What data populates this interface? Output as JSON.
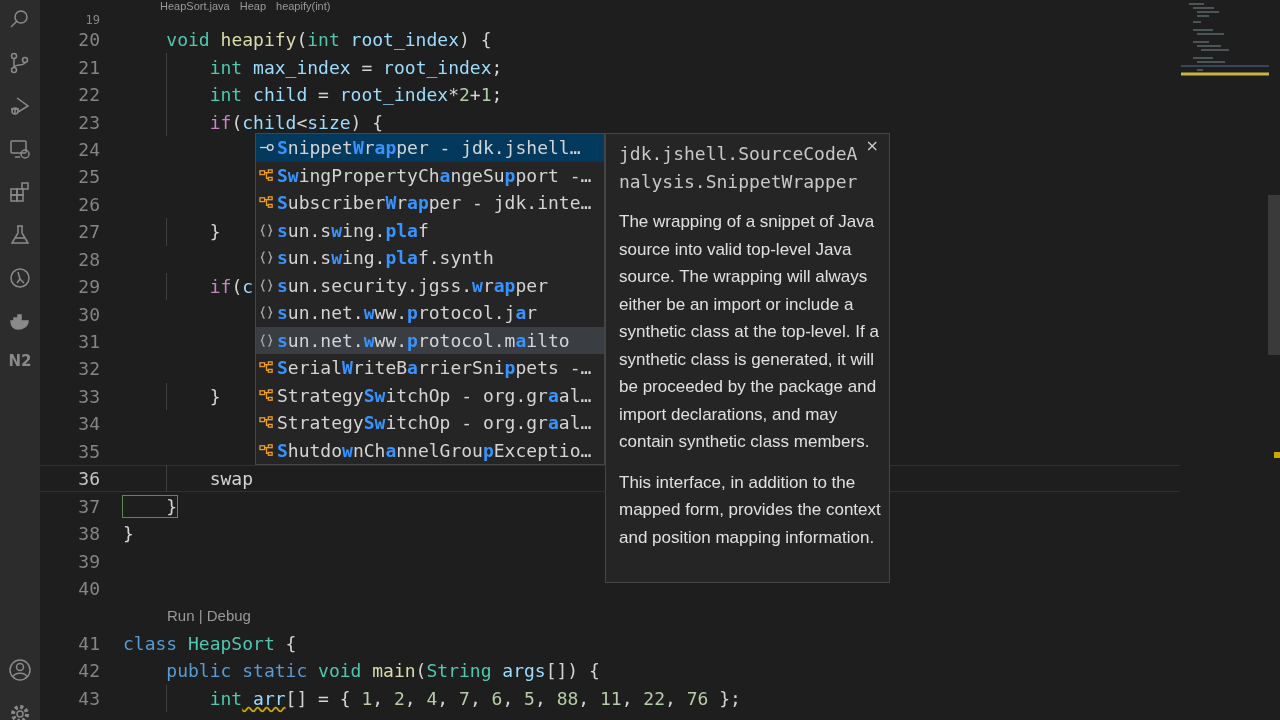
{
  "breadcrumb": [
    "HeapSort.java",
    "Heap",
    "heapify(int)"
  ],
  "activity_bar": {
    "logo_label": "N2"
  },
  "editor": {
    "lines": [
      {
        "number": "19",
        "current": false
      },
      {
        "number": "20",
        "current": false,
        "tokens": [
          {
            "text": "    void",
            "kind": "type"
          },
          {
            "text": " heapify",
            "kind": "func"
          },
          {
            "text": "(",
            "kind": "plain"
          },
          {
            "text": "int",
            "kind": "type"
          },
          {
            "text": " root_index",
            "kind": "var"
          },
          {
            "text": ") {",
            "kind": "plain"
          }
        ]
      },
      {
        "number": "21",
        "current": false,
        "tokens": [
          {
            "text": "        int",
            "kind": "type"
          },
          {
            "text": " max_index",
            "kind": "var"
          },
          {
            "text": " =",
            "kind": "plain"
          },
          {
            "text": " root_index",
            "kind": "var"
          },
          {
            "text": ";",
            "kind": "plain"
          }
        ]
      },
      {
        "number": "22",
        "current": false,
        "tokens": [
          {
            "text": "        int",
            "kind": "type"
          },
          {
            "text": " child",
            "kind": "var"
          },
          {
            "text": " =",
            "kind": "plain"
          },
          {
            "text": " root_index",
            "kind": "var"
          },
          {
            "text": "*",
            "kind": "plain"
          },
          {
            "text": "2",
            "kind": "number"
          },
          {
            "text": "+",
            "kind": "plain"
          },
          {
            "text": "1",
            "kind": "number"
          },
          {
            "text": ";",
            "kind": "plain"
          }
        ]
      },
      {
        "number": "23",
        "current": false,
        "tokens": [
          {
            "text": "        if",
            "kind": "control"
          },
          {
            "text": "(",
            "kind": "plain"
          },
          {
            "text": "child",
            "kind": "var"
          },
          {
            "text": "<",
            "kind": "plain"
          },
          {
            "text": "size",
            "kind": "var"
          },
          {
            "text": ") {",
            "kind": "plain"
          }
        ]
      },
      {
        "number": "24",
        "current": false
      },
      {
        "number": "25",
        "current": false
      },
      {
        "number": "26",
        "current": false
      },
      {
        "number": "27",
        "current": false,
        "tokens": [
          {
            "text": "        }",
            "kind": "plain"
          }
        ]
      },
      {
        "number": "28",
        "current": false
      },
      {
        "number": "29",
        "current": false,
        "tokens": [
          {
            "text": "        if",
            "kind": "control"
          },
          {
            "text": "(",
            "kind": "plain"
          },
          {
            "text": "c",
            "kind": "var"
          }
        ]
      },
      {
        "number": "30",
        "current": false
      },
      {
        "number": "31",
        "current": false
      },
      {
        "number": "32",
        "current": false
      },
      {
        "number": "33",
        "current": false,
        "tokens": [
          {
            "text": "        }",
            "kind": "plain"
          }
        ]
      },
      {
        "number": "34",
        "current": false
      },
      {
        "number": "35",
        "current": false
      },
      {
        "number": "36",
        "current": true,
        "tokens": [
          {
            "text": "        swap",
            "kind": "plain"
          }
        ]
      },
      {
        "number": "37",
        "current": false,
        "tokens": [
          {
            "text": "    }",
            "kind": "bracket-match"
          }
        ]
      },
      {
        "number": "38",
        "current": false,
        "tokens": [
          {
            "text": "}",
            "kind": "plain"
          }
        ]
      },
      {
        "number": "39",
        "current": false
      },
      {
        "number": "40",
        "current": false
      },
      {
        "number": "41",
        "current": false,
        "tokens": [
          {
            "text": "class",
            "kind": "keyword"
          },
          {
            "text": " HeapSort",
            "kind": "type"
          },
          {
            "text": " {",
            "kind": "plain"
          }
        ],
        "codelens": "Run | Debug"
      },
      {
        "number": "42",
        "current": false,
        "tokens": [
          {
            "text": "    public",
            "kind": "keyword"
          },
          {
            "text": " static",
            "kind": "keyword"
          },
          {
            "text": " void",
            "kind": "type"
          },
          {
            "text": " main",
            "kind": "func"
          },
          {
            "text": "(",
            "kind": "plain"
          },
          {
            "text": "String",
            "kind": "type"
          },
          {
            "text": " args",
            "kind": "var"
          },
          {
            "text": "[]) {",
            "kind": "plain"
          }
        ]
      },
      {
        "number": "43",
        "current": false,
        "tokens": [
          {
            "text": "        int",
            "kind": "type"
          },
          {
            "text": " arr",
            "kind": "warn-var"
          },
          {
            "text": "[] = {",
            "kind": "plain"
          },
          {
            "text": " 1",
            "kind": "number"
          },
          {
            "text": ",",
            "kind": "plain"
          },
          {
            "text": " 2",
            "kind": "number"
          },
          {
            "text": ",",
            "kind": "plain"
          },
          {
            "text": " 4",
            "kind": "number"
          },
          {
            "text": ",",
            "kind": "plain"
          },
          {
            "text": " 7",
            "kind": "number"
          },
          {
            "text": ",",
            "kind": "plain"
          },
          {
            "text": " 6",
            "kind": "number"
          },
          {
            "text": ",",
            "kind": "plain"
          },
          {
            "text": " 5",
            "kind": "number"
          },
          {
            "text": ",",
            "kind": "plain"
          },
          {
            "text": " 88",
            "kind": "number"
          },
          {
            "text": ",",
            "kind": "plain"
          },
          {
            "text": " 11",
            "kind": "number"
          },
          {
            "text": ",",
            "kind": "plain"
          },
          {
            "text": " 22",
            "kind": "number"
          },
          {
            "text": ",",
            "kind": "plain"
          },
          {
            "text": " 76",
            "kind": "number"
          },
          {
            "text": " };",
            "kind": "plain"
          }
        ]
      }
    ]
  },
  "suggestions": [
    {
      "kind": "field",
      "selected": true,
      "hovered": false,
      "parts": [
        {
          "text": "S",
          "match": true
        },
        {
          "text": "nippet",
          "match": false
        },
        {
          "text": "W",
          "match": true
        },
        {
          "text": "r",
          "match": false
        },
        {
          "text": "ap",
          "match": true
        },
        {
          "text": "per - jdk.jshell…",
          "match": false
        }
      ]
    },
    {
      "kind": "class",
      "selected": false,
      "hovered": false,
      "parts": [
        {
          "text": "Sw",
          "match": true
        },
        {
          "text": "ingPropertyCh",
          "match": false
        },
        {
          "text": "a",
          "match": true
        },
        {
          "text": "ngeSu",
          "match": false
        },
        {
          "text": "p",
          "match": true
        },
        {
          "text": "port -…",
          "match": false
        }
      ]
    },
    {
      "kind": "class",
      "selected": false,
      "hovered": false,
      "parts": [
        {
          "text": "S",
          "match": true
        },
        {
          "text": "ubscriber",
          "match": false
        },
        {
          "text": "W",
          "match": true
        },
        {
          "text": "r",
          "match": false
        },
        {
          "text": "ap",
          "match": true
        },
        {
          "text": "per - jdk.inte…",
          "match": false
        }
      ]
    },
    {
      "kind": "module",
      "selected": false,
      "hovered": false,
      "parts": [
        {
          "text": "s",
          "match": true
        },
        {
          "text": "un.s",
          "match": false
        },
        {
          "text": "w",
          "match": true
        },
        {
          "text": "ing.",
          "match": false
        },
        {
          "text": "pla",
          "match": true
        },
        {
          "text": "f",
          "match": false
        }
      ]
    },
    {
      "kind": "module",
      "selected": false,
      "hovered": false,
      "parts": [
        {
          "text": "s",
          "match": true
        },
        {
          "text": "un.s",
          "match": false
        },
        {
          "text": "w",
          "match": true
        },
        {
          "text": "ing.",
          "match": false
        },
        {
          "text": "pla",
          "match": true
        },
        {
          "text": "f.synth",
          "match": false
        }
      ]
    },
    {
      "kind": "module",
      "selected": false,
      "hovered": false,
      "parts": [
        {
          "text": "s",
          "match": true
        },
        {
          "text": "un.security.jgss.",
          "match": false
        },
        {
          "text": "w",
          "match": true
        },
        {
          "text": "r",
          "match": false
        },
        {
          "text": "ap",
          "match": true
        },
        {
          "text": "per",
          "match": false
        }
      ]
    },
    {
      "kind": "module",
      "selected": false,
      "hovered": false,
      "parts": [
        {
          "text": "s",
          "match": true
        },
        {
          "text": "un.net.",
          "match": false
        },
        {
          "text": "w",
          "match": true
        },
        {
          "text": "ww.",
          "match": false
        },
        {
          "text": "p",
          "match": true
        },
        {
          "text": "rotocol.j",
          "match": false
        },
        {
          "text": "a",
          "match": true
        },
        {
          "text": "r",
          "match": false
        }
      ]
    },
    {
      "kind": "module",
      "selected": false,
      "hovered": true,
      "parts": [
        {
          "text": "s",
          "match": true
        },
        {
          "text": "un.net.",
          "match": false
        },
        {
          "text": "w",
          "match": true
        },
        {
          "text": "ww.",
          "match": false
        },
        {
          "text": "p",
          "match": true
        },
        {
          "text": "rotocol.m",
          "match": false
        },
        {
          "text": "a",
          "match": true
        },
        {
          "text": "ilto",
          "match": false
        }
      ]
    },
    {
      "kind": "class",
      "selected": false,
      "hovered": false,
      "parts": [
        {
          "text": "S",
          "match": true
        },
        {
          "text": "erial",
          "match": false
        },
        {
          "text": "W",
          "match": true
        },
        {
          "text": "riteB",
          "match": false
        },
        {
          "text": "a",
          "match": true
        },
        {
          "text": "rrierSni",
          "match": false
        },
        {
          "text": "p",
          "match": true
        },
        {
          "text": "pets -…",
          "match": false
        }
      ]
    },
    {
      "kind": "class",
      "selected": false,
      "hovered": false,
      "parts": [
        {
          "text": "Strategy",
          "match": false
        },
        {
          "text": "Sw",
          "match": true
        },
        {
          "text": "itchOp - org.gr",
          "match": false
        },
        {
          "text": "a",
          "match": true
        },
        {
          "text": "al…",
          "match": false
        }
      ]
    },
    {
      "kind": "class",
      "selected": false,
      "hovered": false,
      "parts": [
        {
          "text": "Strategy",
          "match": false
        },
        {
          "text": "Sw",
          "match": true
        },
        {
          "text": "itchOp - org.gr",
          "match": false
        },
        {
          "text": "a",
          "match": true
        },
        {
          "text": "al…",
          "match": false
        }
      ]
    },
    {
      "kind": "class",
      "selected": false,
      "hovered": false,
      "parts": [
        {
          "text": "S",
          "match": true
        },
        {
          "text": "hutdo",
          "match": false
        },
        {
          "text": "w",
          "match": true
        },
        {
          "text": "nCh",
          "match": false
        },
        {
          "text": "a",
          "match": true
        },
        {
          "text": "nnelGrou",
          "match": false
        },
        {
          "text": "p",
          "match": true
        },
        {
          "text": "Exceptio…",
          "match": false
        }
      ]
    }
  ],
  "details": {
    "title": "jdk.jshell.SourceCodeAnalysis.SnippetWrapper",
    "close": "×",
    "paragraphs": [
      "The wrapping of a snippet of Java source into valid top-level Java source. The wrapping will always either be an import or include a synthetic class at the top-level. If a synthetic class is generated, it will be proceeded by the package and import declarations, and may contain synthetic class members.",
      "This interface, in addition to the mapped form, provides the context and position mapping information."
    ]
  }
}
